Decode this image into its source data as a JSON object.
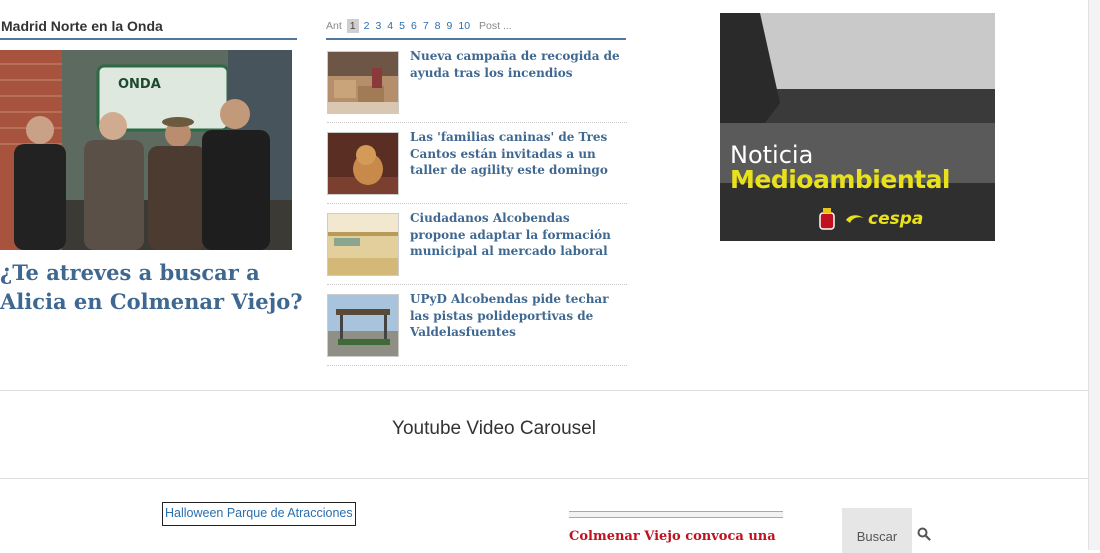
{
  "section": {
    "title": "Madrid Norte en la Onda"
  },
  "feature": {
    "title": "¿Te atreves a buscar a Alicia en Colmenar Viejo?",
    "sign_text": "ONDA"
  },
  "pager": {
    "prev": "Ant",
    "current": "1",
    "pages": [
      "2",
      "3",
      "4",
      "5",
      "6",
      "7",
      "8",
      "9",
      "10"
    ],
    "next": "Post ..."
  },
  "news": [
    {
      "title": "Nueva campaña de recogida de ayuda tras los incendios"
    },
    {
      "title": "Las 'familias caninas' de Tres Cantos están invitadas a un taller de agility este domingo"
    },
    {
      "title": "Ciudadanos Alcobendas propone adaptar la formación municipal al mercado laboral"
    },
    {
      "title": "UPyD Alcobendas pide techar las pistas polideportivas de Valdelasfuentes"
    }
  ],
  "ad": {
    "line1": "Noticia",
    "line2": "Medioambiental",
    "brand": "cespa"
  },
  "carousel": {
    "title": "Youtube Video Carousel"
  },
  "halloween_link": "Halloween Parque de Atracciones",
  "widget": {
    "headline": "Colmenar Viejo convoca una"
  },
  "search": {
    "button_label": "Buscar"
  },
  "colors": {
    "link_blue": "#3f6891",
    "accent_red": "#c0111f",
    "rule_blue": "#52779f"
  }
}
